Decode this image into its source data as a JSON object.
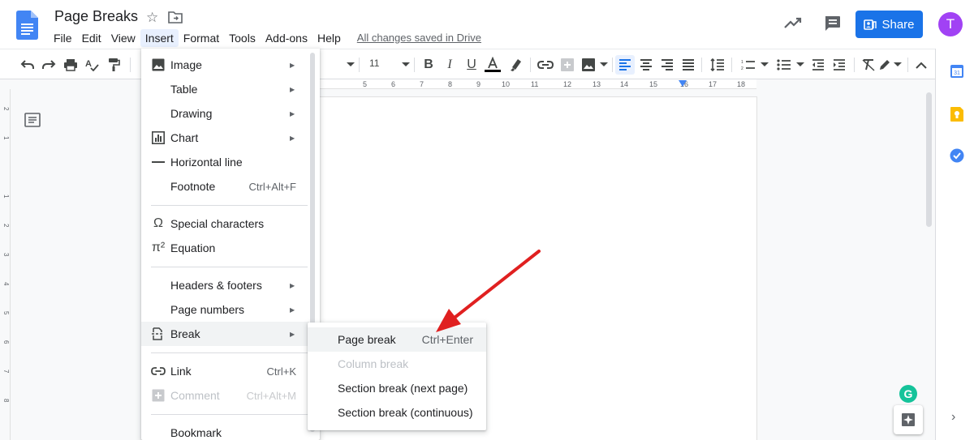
{
  "header": {
    "doc_title": "Page Breaks",
    "save_status": "All changes saved in Drive",
    "share_label": "Share",
    "avatar_initial": "T"
  },
  "menubar": [
    {
      "label": "File"
    },
    {
      "label": "Edit"
    },
    {
      "label": "View"
    },
    {
      "label": "Insert",
      "active": true
    },
    {
      "label": "Format"
    },
    {
      "label": "Tools"
    },
    {
      "label": "Add-ons"
    },
    {
      "label": "Help"
    }
  ],
  "toolbar": {
    "font_size": "11"
  },
  "ruler": {
    "numbers": [
      "5",
      "6",
      "7",
      "8",
      "9",
      "10",
      "11",
      "12",
      "13",
      "14",
      "15",
      "16",
      "17",
      "18"
    ]
  },
  "vertical_ruler": {
    "numbers": [
      "2",
      "1",
      "1",
      "2",
      "3",
      "4",
      "5",
      "6",
      "7",
      "8"
    ]
  },
  "insert_menu": {
    "items": [
      {
        "label": "Image",
        "icon": "image-icon",
        "submenu": true
      },
      {
        "label": "Table",
        "submenu": true
      },
      {
        "label": "Drawing",
        "submenu": true
      },
      {
        "label": "Chart",
        "icon": "chart-icon",
        "submenu": true
      },
      {
        "label": "Horizontal line",
        "icon": "horizontal-line-icon"
      },
      {
        "label": "Footnote",
        "shortcut": "Ctrl+Alt+F"
      },
      {
        "label": "Special characters",
        "icon": "omega-icon"
      },
      {
        "label": "Equation",
        "icon": "pi-icon"
      },
      {
        "label": "Headers & footers",
        "submenu": true
      },
      {
        "label": "Page numbers",
        "submenu": true
      },
      {
        "label": "Break",
        "icon": "break-icon",
        "submenu": true,
        "hovered": true
      },
      {
        "label": "Link",
        "icon": "link-icon",
        "shortcut": "Ctrl+K"
      },
      {
        "label": "Comment",
        "icon": "add-comment-icon",
        "shortcut": "Ctrl+Alt+M",
        "disabled": true
      },
      {
        "label": "Bookmark"
      }
    ]
  },
  "break_submenu": {
    "items": [
      {
        "label": "Page break",
        "shortcut": "Ctrl+Enter",
        "hovered": true
      },
      {
        "label": "Column break",
        "disabled": true
      },
      {
        "label": "Section break (next page)"
      },
      {
        "label": "Section break (continuous)"
      }
    ]
  },
  "colors": {
    "accent": "#1a73e8",
    "avatar": "#a142f4",
    "annotation_arrow": "#e02020",
    "grammarly": "#15c39a"
  }
}
